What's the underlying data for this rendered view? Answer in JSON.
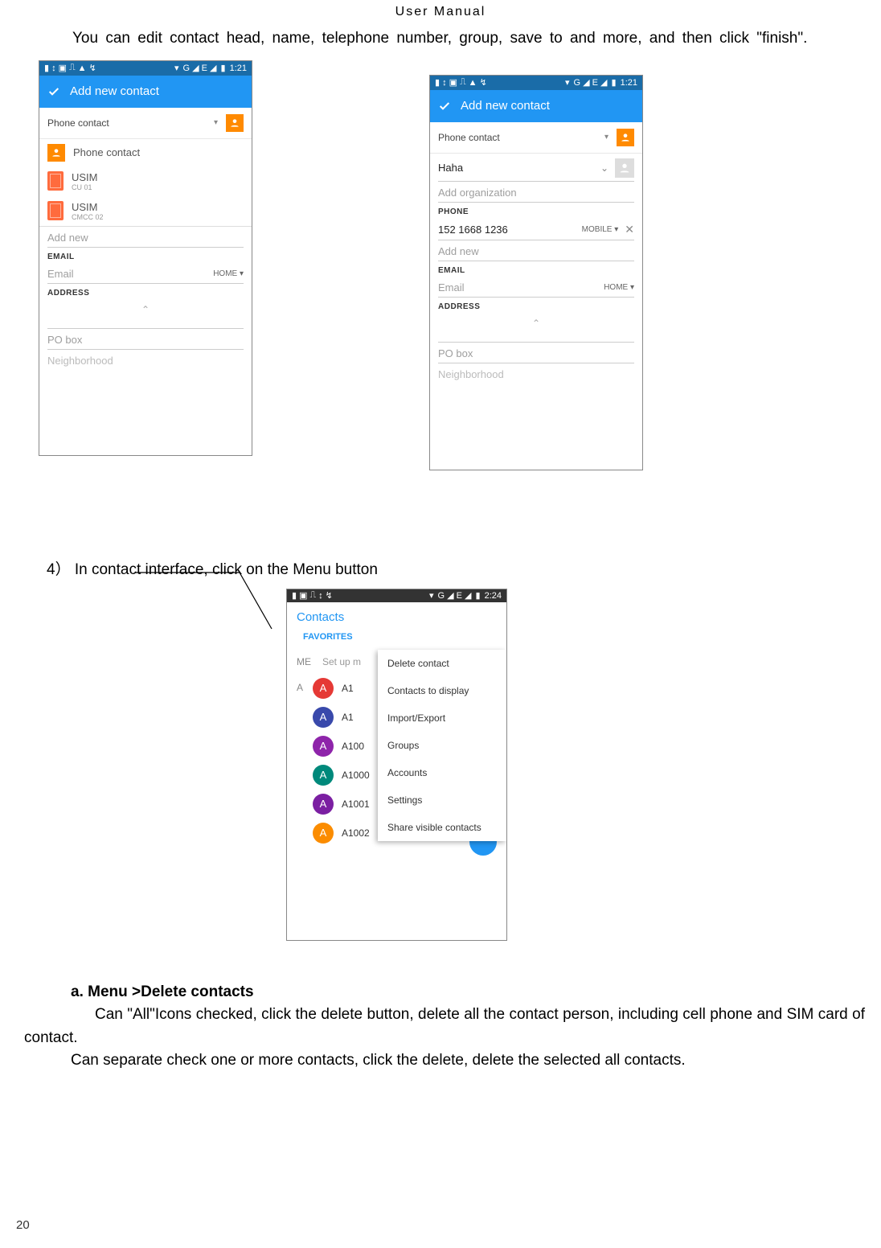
{
  "header": "User   Manual",
  "intro": "You can edit contact head, name, telephone number, group, save to and more, and then click \"finish\".",
  "status": {
    "time": "1:21",
    "time3": "2:24",
    "signal": "G ◢ E ◢",
    "wifi": "▾",
    "battery": "▮"
  },
  "phone1": {
    "title": "Add new contact",
    "account": "Phone contact",
    "options": [
      {
        "name": "Phone contact"
      },
      {
        "name": "USIM",
        "sub": "CU 01"
      },
      {
        "name": "USIM",
        "sub": "CMCC 02"
      }
    ],
    "addnew": "Add new",
    "email_label": "EMAIL",
    "email_ph": "Email",
    "email_type": "HOME ▾",
    "address_label": "ADDRESS",
    "pobox": "PO box",
    "neigh": "Neighborhood"
  },
  "phone2": {
    "title": "Add new contact",
    "account": "Phone contact",
    "name_val": "Haha",
    "addorg": "Add organization",
    "phone_label": "PHONE",
    "phone_val": "152 1668 1236",
    "phone_type": "MOBILE ▾",
    "addnew": "Add new",
    "email_label": "EMAIL",
    "email_ph": "Email",
    "email_type": "HOME ▾",
    "address_label": "ADDRESS",
    "pobox": "PO box",
    "neigh": "Neighborhood"
  },
  "step4": "4） In contact   interface, click on the Menu button",
  "phone3": {
    "header": "Contacts",
    "tab": "FAVORITES",
    "me": "ME",
    "setup": "Set up m",
    "alpha": "A",
    "contacts": [
      "A1",
      "A1",
      "A100",
      "A1000",
      "A1001",
      "A1002"
    ],
    "menu": [
      "Delete contact",
      "Contacts to display",
      "Import/Export",
      "Groups",
      "Accounts",
      "Settings",
      "Share visible contacts"
    ]
  },
  "section_a": {
    "head": "a.   Menu >Delete contacts",
    "p1": "Can \"All\"Icons checked, click the delete button, delete all the contact person, including cell phone and SIM card of contact.",
    "p2": "Can separate check one or more contacts, click the delete, delete the selected all contacts."
  },
  "page_num": "20"
}
